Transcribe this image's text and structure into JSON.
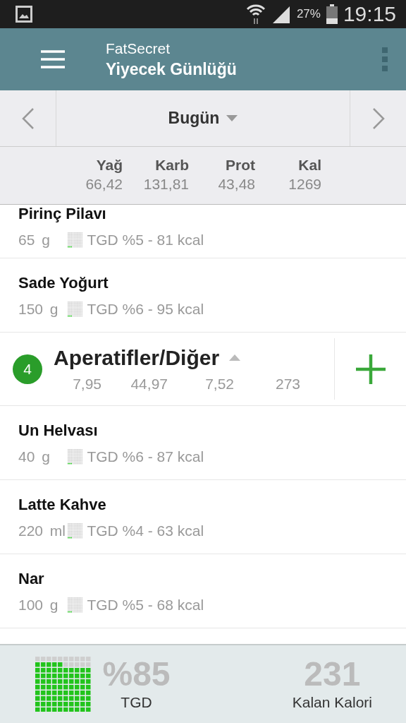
{
  "status_bar": {
    "battery": "27%",
    "time": "19:15"
  },
  "app_bar": {
    "app_name": "FatSecret",
    "title": "Yiyecek Günlüğü"
  },
  "date_nav": {
    "label": "Bugün"
  },
  "totals": {
    "columns": [
      {
        "label": "Yağ",
        "value": "66,42"
      },
      {
        "label": "Karb",
        "value": "131,81"
      },
      {
        "label": "Prot",
        "value": "43,48"
      },
      {
        "label": "Kal",
        "value": "1269"
      }
    ]
  },
  "entries": [
    {
      "kind": "food",
      "name": "Pirinç Pilavı",
      "amount": "65 g",
      "rdi": "TGD %5 - 81 kcal"
    },
    {
      "kind": "food",
      "name": "Sade Yoğurt",
      "amount": "150 g",
      "rdi": "TGD %6 - 95 kcal"
    },
    {
      "kind": "meal",
      "badge": "4",
      "name": "Aperatifler/Diğer",
      "expanded": true,
      "values": [
        "7,95",
        "44,97",
        "7,52",
        "273"
      ]
    },
    {
      "kind": "food",
      "name": "Un Helvası",
      "amount": "40 g",
      "rdi": "TGD %6 - 87 kcal"
    },
    {
      "kind": "food",
      "name": "Latte Kahve",
      "amount": "220 ml",
      "rdi": "TGD %4 - 63 kcal"
    },
    {
      "kind": "food",
      "name": "Nar",
      "amount": "100 g",
      "rdi": "TGD %5 - 68 kcal"
    }
  ],
  "summary": {
    "percent": "%85",
    "percent_label": "TGD",
    "remaining": "231",
    "remaining_label": "Kalan Kalori"
  }
}
